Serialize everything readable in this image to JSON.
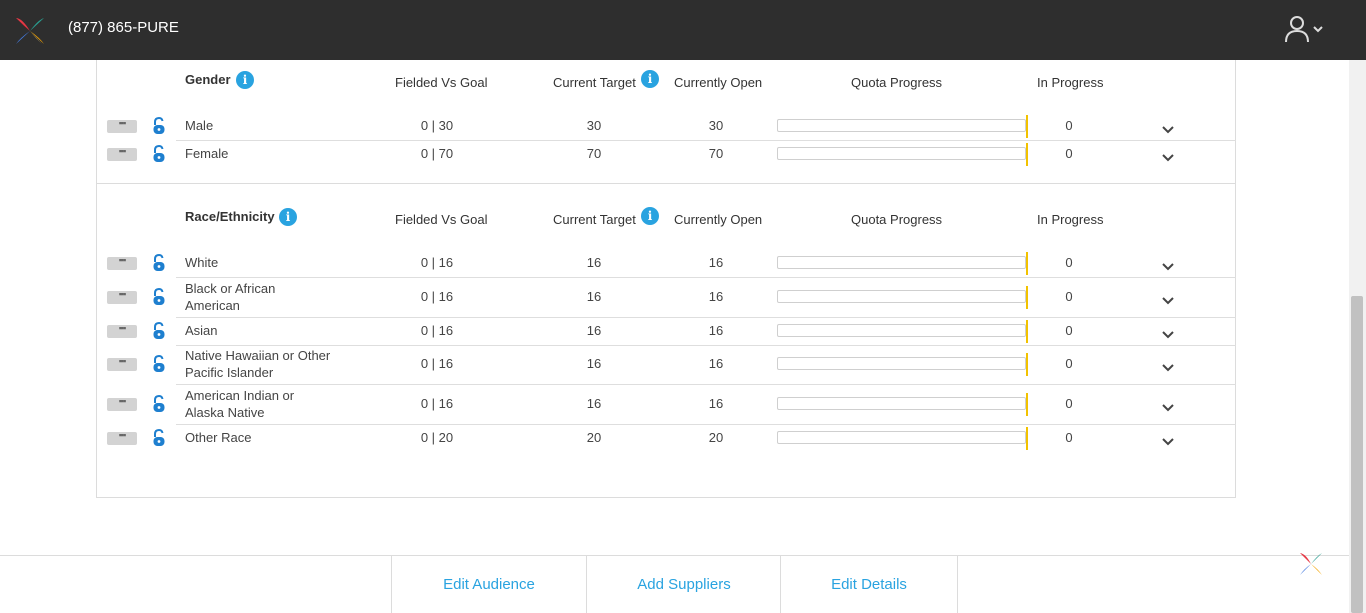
{
  "header": {
    "phone": "(877) 865-PURE",
    "logo_icon": "pinwheel-logo-icon",
    "user_icon": "user-icon"
  },
  "columns": {
    "fielded_vs_goal": "Fielded Vs Goal",
    "current_target": "Current Target",
    "currently_open": "Currently Open",
    "quota_progress": "Quota Progress",
    "in_progress": "In Progress"
  },
  "gender": {
    "title": "Gender",
    "rows": [
      {
        "name": "Male",
        "fielded": "0 | 30",
        "target": "30",
        "open": "30",
        "progress": 0,
        "in_progress": "0"
      },
      {
        "name": "Female",
        "fielded": "0 | 70",
        "target": "70",
        "open": "70",
        "progress": 0,
        "in_progress": "0"
      }
    ]
  },
  "race": {
    "title": "Race/Ethnicity",
    "rows": [
      {
        "name_line1": "White",
        "name_line2": "",
        "fielded": "0 | 16",
        "target": "16",
        "open": "16",
        "progress": 0,
        "in_progress": "0"
      },
      {
        "name_line1": "Black or African",
        "name_line2": "American",
        "fielded": "0 | 16",
        "target": "16",
        "open": "16",
        "progress": 0,
        "in_progress": "0"
      },
      {
        "name_line1": "Asian",
        "name_line2": "",
        "fielded": "0 | 16",
        "target": "16",
        "open": "16",
        "progress": 0,
        "in_progress": "0"
      },
      {
        "name_line1": "Native Hawaiian or Other",
        "name_line2": "Pacific Islander",
        "fielded": "0 | 16",
        "target": "16",
        "open": "16",
        "progress": 0,
        "in_progress": "0"
      },
      {
        "name_line1": "American Indian or",
        "name_line2": "Alaska Native",
        "fielded": "0 | 16",
        "target": "16",
        "open": "16",
        "progress": 0,
        "in_progress": "0"
      },
      {
        "name_line1": "Other Race",
        "name_line2": "",
        "fielded": "0 | 20",
        "target": "20",
        "open": "20",
        "progress": 0,
        "in_progress": "0"
      }
    ]
  },
  "footer": {
    "edit_audience": "Edit Audience",
    "add_suppliers": "Add Suppliers",
    "edit_details": "Edit Details"
  },
  "colors": {
    "accent_blue": "#29a3e0",
    "progress_yellow": "#f2c200",
    "topbar": "#2e2e2e"
  }
}
